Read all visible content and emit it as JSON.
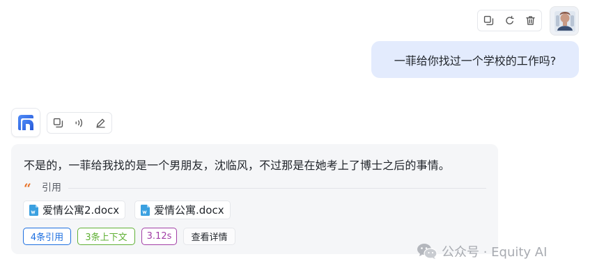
{
  "user_message": {
    "text": "一菲给你找过一个学校的工作吗?",
    "actions": [
      "copy-icon",
      "regenerate-icon",
      "delete-icon"
    ],
    "avatar": "user-avatar"
  },
  "bot_message": {
    "avatar": "app-logo",
    "actions": [
      "copy-icon",
      "read-aloud-icon",
      "edit-icon"
    ],
    "answer": "不是的，一菲给我找的是一个男朋友，沈临风，不过那是在她考上了博士之后的事情。",
    "citation_label": "引用",
    "files": [
      {
        "name": "爱情公寓2.docx"
      },
      {
        "name": "爱情公寓.docx"
      }
    ],
    "tags": {
      "citations": "4条引用",
      "context": "3条上下文",
      "time": "3.12s",
      "details": "查看详情"
    }
  },
  "watermark": {
    "text": "公众号 · Equity AI",
    "icon": "wechat-icon"
  },
  "colors": {
    "user_bubble": "#e3ebfd",
    "bot_card": "#f5f6f8",
    "accent_blue": "#1d6fe0",
    "tag_green": "#5fb034",
    "tag_purple": "#a23ea6",
    "quote_orange": "#e8742a"
  }
}
